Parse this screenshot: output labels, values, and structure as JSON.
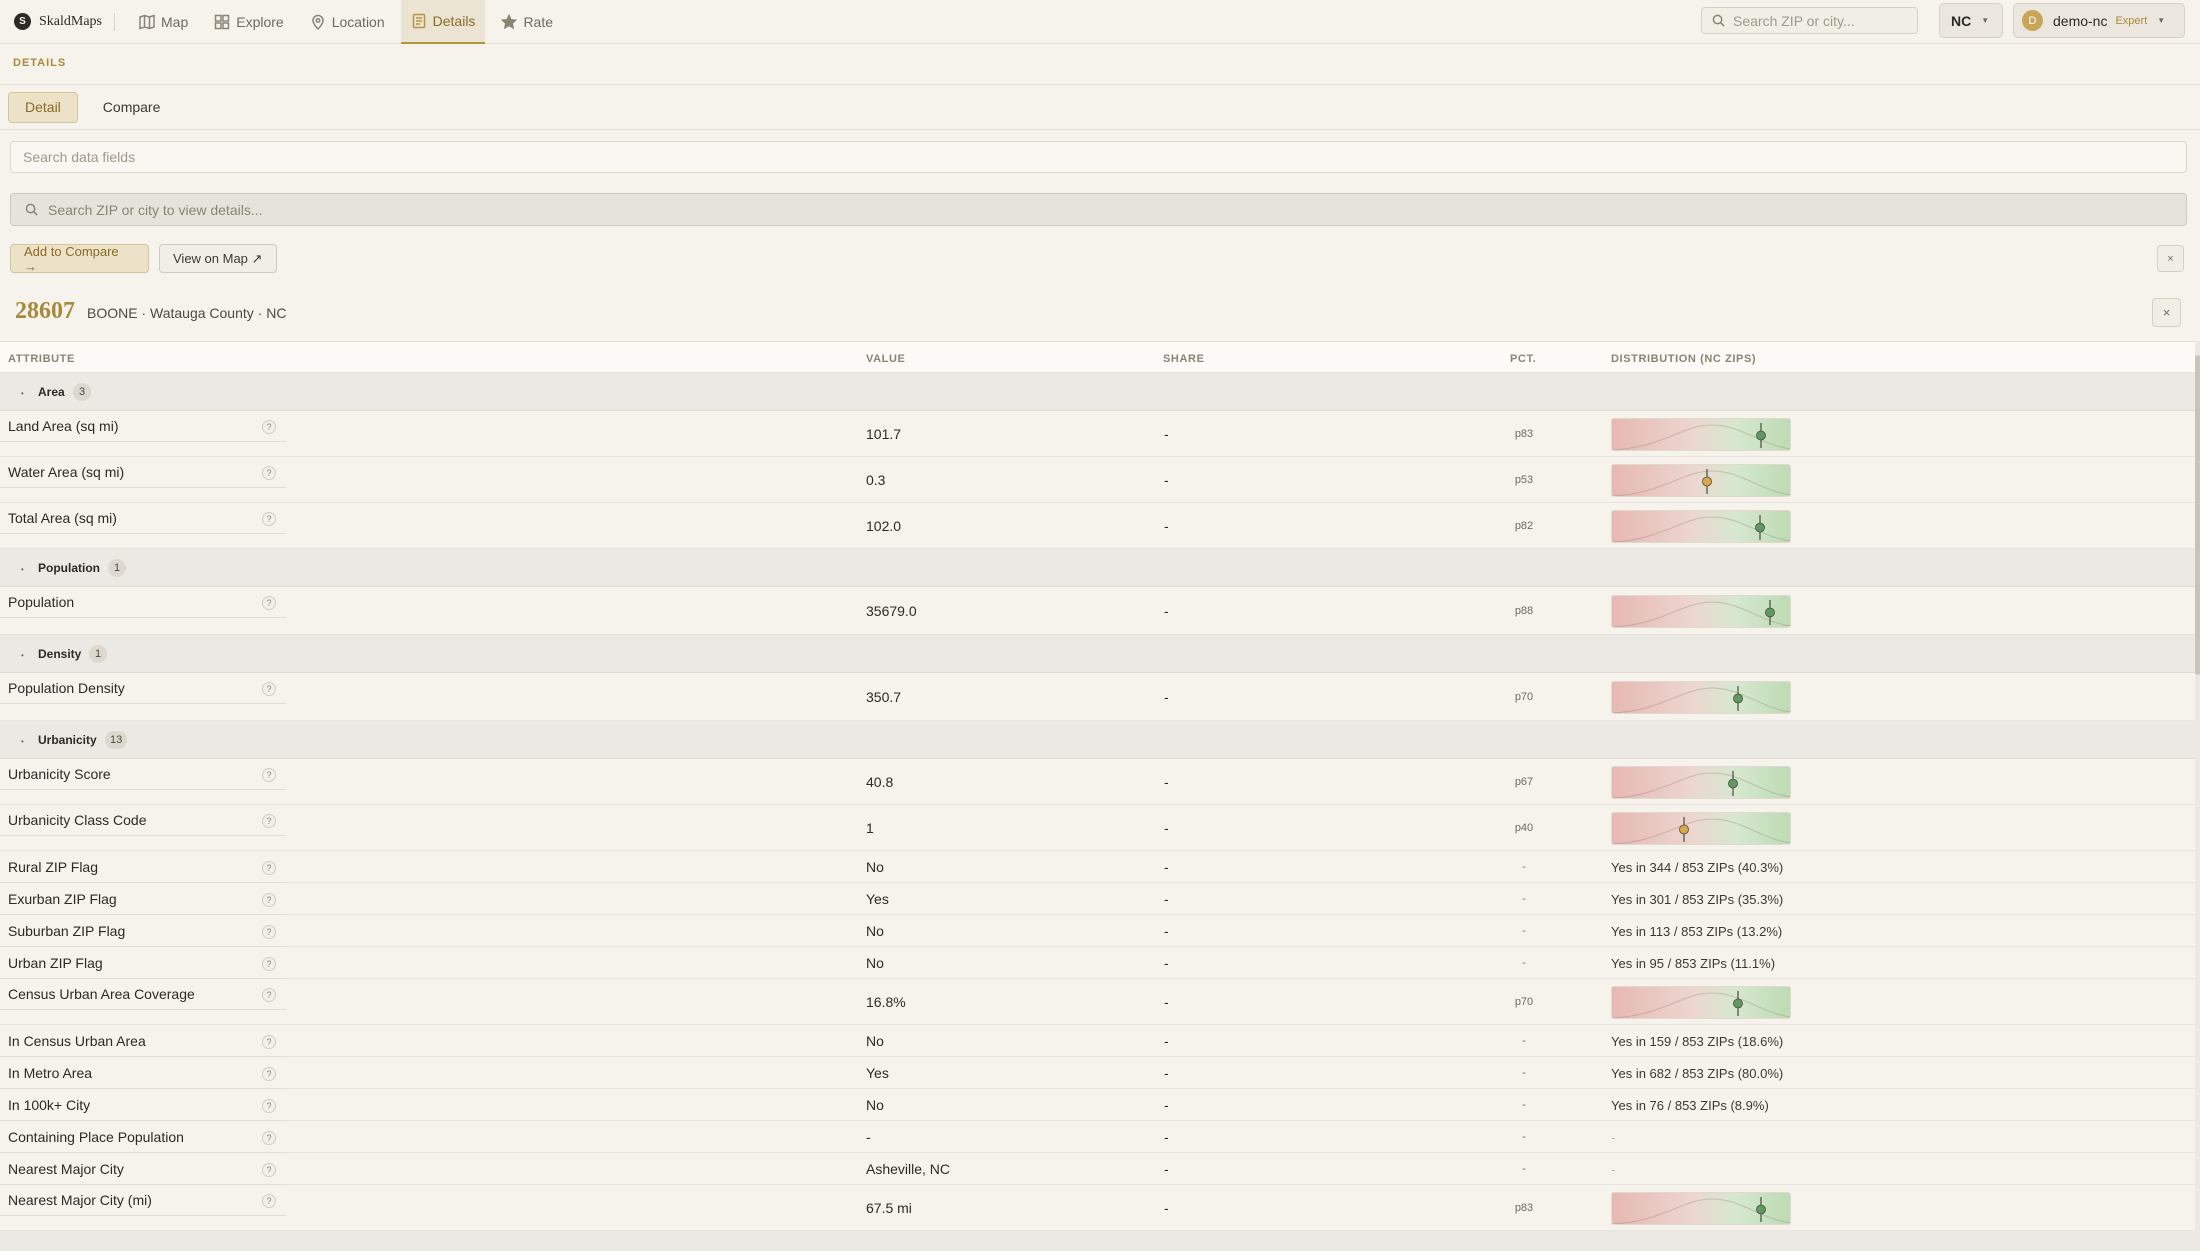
{
  "app": {
    "brand": "SkaldMaps"
  },
  "nav": {
    "tabs": [
      {
        "label": "Map",
        "icon": "map-icon"
      },
      {
        "label": "Explore",
        "icon": "grid-icon"
      },
      {
        "label": "Location",
        "icon": "pin-icon"
      },
      {
        "label": "Details",
        "icon": "document-icon",
        "active": true
      },
      {
        "label": "Rate",
        "icon": "star-icon"
      }
    ],
    "search_placeholder": "Search ZIP or city...",
    "state": "NC",
    "user": {
      "initial": "D",
      "name": "demo-nc",
      "badge": "Expert"
    }
  },
  "details": {
    "section_title": "DETAILS",
    "subtabs": [
      "Detail",
      "Compare"
    ],
    "active_subtab": "Detail",
    "field_search_placeholder": "Search data fields",
    "zip_search_placeholder": "Search ZIP or city to view details...",
    "add_compare_label": "Add to Compare →",
    "view_map_label": "View on Map ↗",
    "close_label": "×",
    "zip": "28607",
    "place": "BOONE · Watauga County · NC"
  },
  "table": {
    "headers": {
      "attribute": "ATTRIBUTE",
      "value": "VALUE",
      "share": "SHARE",
      "pct": "PCT.",
      "distribution": "DISTRIBUTION (NC ZIPS)"
    },
    "groups": [
      {
        "name": "Area",
        "count": "3"
      },
      {
        "name": "Population",
        "count": "1"
      },
      {
        "name": "Density",
        "count": "1"
      },
      {
        "name": "Urbanicity",
        "count": "13"
      }
    ],
    "rows": [
      {
        "attr": "Land Area (sq mi)",
        "value": "101.7",
        "share": "-",
        "pct": "p83",
        "percentile": 83
      },
      {
        "attr": "Water Area (sq mi)",
        "value": "0.3",
        "share": "-",
        "pct": "p53",
        "percentile": 53
      },
      {
        "attr": "Total Area (sq mi)",
        "value": "102.0",
        "share": "-",
        "pct": "p82",
        "percentile": 82
      },
      {
        "attr": "Population",
        "value": "35679.0",
        "share": "-",
        "pct": "p88",
        "percentile": 88
      },
      {
        "attr": "Population Density",
        "value": "350.7",
        "share": "-",
        "pct": "p70",
        "percentile": 70
      },
      {
        "attr": "Urbanicity Score",
        "value": "40.8",
        "share": "-",
        "pct": "p67",
        "percentile": 67
      },
      {
        "attr": "Urbanicity Class Code",
        "value": "1",
        "share": "-",
        "pct": "p40",
        "percentile": 40
      },
      {
        "attr": "Rural ZIP Flag",
        "value": "No",
        "share": "-",
        "pct": "-",
        "dist": "Yes in 344 / 853 ZIPs (40.3%)"
      },
      {
        "attr": "Exurban ZIP Flag",
        "value": "Yes",
        "share": "-",
        "pct": "-",
        "dist": "Yes in 301 / 853 ZIPs (35.3%)"
      },
      {
        "attr": "Suburban ZIP Flag",
        "value": "No",
        "share": "-",
        "pct": "-",
        "dist": "Yes in 113 / 853 ZIPs (13.2%)"
      },
      {
        "attr": "Urban ZIP Flag",
        "value": "No",
        "share": "-",
        "pct": "-",
        "dist": "Yes in 95 / 853 ZIPs (11.1%)"
      },
      {
        "attr": "Census Urban Area Coverage",
        "value": "16.8%",
        "share": "-",
        "pct": "p70",
        "percentile": 70
      },
      {
        "attr": "In Census Urban Area",
        "value": "No",
        "share": "-",
        "pct": "-",
        "dist": "Yes in 159 / 853 ZIPs (18.6%)"
      },
      {
        "attr": "In Metro Area",
        "value": "Yes",
        "share": "-",
        "pct": "-",
        "dist": "Yes in 682 / 853 ZIPs (80.0%)"
      },
      {
        "attr": "In 100k+ City",
        "value": "No",
        "share": "-",
        "pct": "-",
        "dist": "Yes in 76 / 853 ZIPs (8.9%)"
      },
      {
        "attr": "Containing Place Population",
        "value": "-",
        "share": "-",
        "pct": "-",
        "dist_empty": "-"
      },
      {
        "attr": "Nearest Major City",
        "value": "Asheville, NC",
        "share": "-",
        "pct": "-",
        "dist_empty": "-"
      },
      {
        "attr": "Nearest Major City (mi)",
        "value": "67.5 mi",
        "share": "-",
        "pct": "p83",
        "percentile": 83
      }
    ]
  },
  "colors": {
    "accent": "#b8933f",
    "marker_high": "#5e9a5e",
    "marker_mid": "#d9a94a"
  }
}
